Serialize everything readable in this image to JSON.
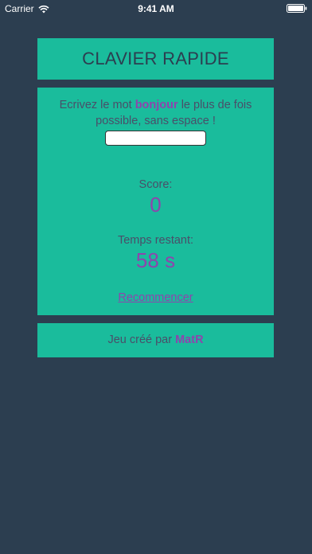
{
  "status_bar": {
    "carrier": "Carrier",
    "time": "9:41 AM",
    "icons": [
      "wifi-icon",
      "battery-icon"
    ]
  },
  "header": {
    "title": "CLAVIER RAPIDE"
  },
  "game": {
    "instruction_prefix": "Ecrivez le mot ",
    "keyword": "bonjour",
    "instruction_suffix": " le plus de fois possible, sans espace !",
    "input_value": "",
    "input_placeholder": "",
    "score_label": "Score:",
    "score_value": "0",
    "time_label": "Temps restant:",
    "time_value": "58 s",
    "restart_label": "Recommencer"
  },
  "footer": {
    "prefix": "Jeu créé par ",
    "author": "MatR"
  },
  "colors": {
    "background": "#2c3e50",
    "card": "#1abc9c",
    "accent": "#8e44ad",
    "text": "#4a4e69"
  }
}
